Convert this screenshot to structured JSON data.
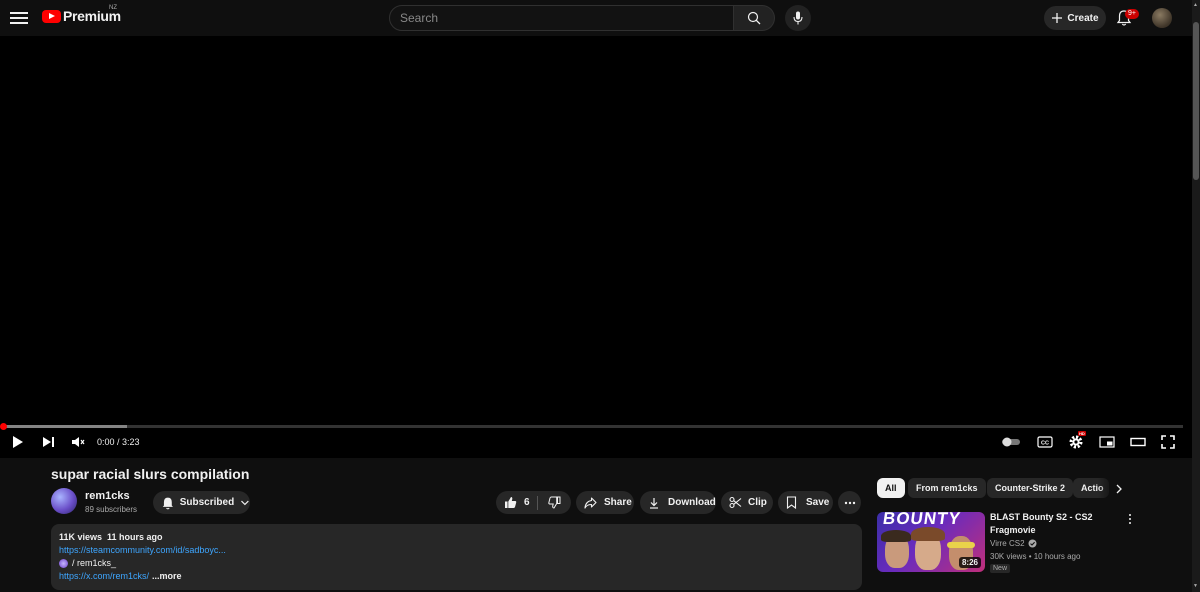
{
  "header": {
    "logo_text": "Premium",
    "region": "NZ",
    "search_placeholder": "Search",
    "create_label": "Create",
    "notification_badge": "9+",
    "icons": [
      "menu-icon",
      "search-icon",
      "mic-icon",
      "plus-icon",
      "bell-icon"
    ]
  },
  "player": {
    "time_display": "0:00 / 3:23",
    "progress_played": 0.0,
    "progress_buffered": 0.105,
    "accent": "#ff0000",
    "controls": [
      "play-icon",
      "next-icon",
      "mute-icon",
      "autoplay-toggle",
      "captions-icon",
      "settings-icon",
      "miniplayer-icon",
      "theater-icon",
      "fullscreen-icon"
    ],
    "settings_badge": "HD"
  },
  "video": {
    "title": "supar racial slurs compilation",
    "channel": "rem1cks",
    "subscribers": "89 subscribers",
    "subscribed_label": "Subscribed",
    "like_count": "6",
    "share_label": "Share",
    "download_label": "Download",
    "clip_label": "Clip",
    "save_label": "Save"
  },
  "description": {
    "views_date": "11K views  11 hours ago",
    "link1": "https://steamcommunity.com/id/sadboyc...",
    "line2": "/ rem1cks_",
    "link2": "https://x.com/rem1cks/",
    "more_label": "...more"
  },
  "chips": [
    "All",
    "From rem1cks",
    "Counter-Strike 2",
    "Actio"
  ],
  "recommendation": {
    "title": "BLAST Bounty S2 - CS2 Fragmovie",
    "channel": "Virre CS2",
    "views": "30K views",
    "age": "10 hours ago",
    "badge": "New",
    "duration": "8:26",
    "thumb_word": "BOUNTY"
  }
}
